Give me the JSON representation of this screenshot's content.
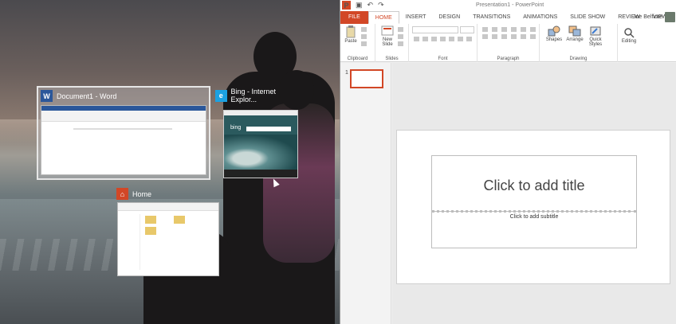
{
  "snap_assist": {
    "windows": [
      {
        "title": "Document1 - Word",
        "icon": "word-icon",
        "icon_letter": "W",
        "icon_color": "#2b579a"
      },
      {
        "title": "Bing - Internet Explor...",
        "icon": "internet-explorer-icon",
        "icon_letter": "e",
        "icon_color": "#1ba1e2",
        "thumb_logo": "bing"
      },
      {
        "title": "Home",
        "icon": "home-icon",
        "icon_letter": "⌂",
        "icon_color": "#d24726"
      }
    ]
  },
  "powerpoint": {
    "window_title": "Presentation1 - PowerPoint",
    "qat": {
      "undo": "↶",
      "redo": "↷"
    },
    "tabs": [
      "FILE",
      "HOME",
      "INSERT",
      "DESIGN",
      "TRANSITIONS",
      "ANIMATIONS",
      "SLIDE SHOW",
      "REVIEW",
      "VIEW"
    ],
    "active_tab": "HOME",
    "user_name": "Joe Belfiore",
    "ribbon": {
      "clipboard": {
        "label": "Clipboard",
        "paste": "Paste"
      },
      "slides": {
        "label": "Slides",
        "new_slide": "New Slide"
      },
      "font": {
        "label": "Font"
      },
      "paragraph": {
        "label": "Paragraph"
      },
      "drawing": {
        "label": "Drawing",
        "shapes": "Shapes",
        "arrange": "Arrange",
        "quick_styles": "Quick Styles"
      },
      "editing": {
        "label": "Editing"
      }
    },
    "slide_number": "1",
    "slide": {
      "title_placeholder": "Click to add title",
      "subtitle_placeholder": "Click to add subtitle"
    },
    "colors": {
      "accent": "#d24726",
      "file_tab": "#d24726"
    }
  }
}
